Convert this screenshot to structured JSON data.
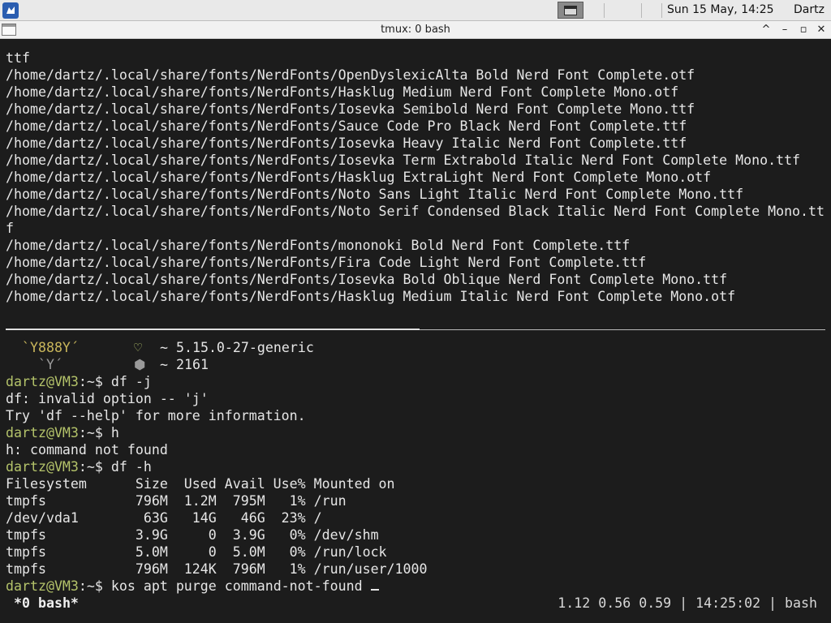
{
  "panel": {
    "clock": "Sun 15 May, 14:25",
    "user": "Dartz"
  },
  "window": {
    "title": "tmux: 0 bash",
    "controls": [
      "^",
      "–",
      "▫",
      "✕"
    ]
  },
  "terminal": {
    "lines": [
      "ttf",
      "/home/dartz/.local/share/fonts/NerdFonts/OpenDyslexicAlta Bold Nerd Font Complete.otf",
      "/home/dartz/.local/share/fonts/NerdFonts/Hasklug Medium Nerd Font Complete Mono.otf",
      "/home/dartz/.local/share/fonts/NerdFonts/Iosevka Semibold Nerd Font Complete Mono.ttf",
      "/home/dartz/.local/share/fonts/NerdFonts/Sauce Code Pro Black Nerd Font Complete.ttf",
      "/home/dartz/.local/share/fonts/NerdFonts/Iosevka Heavy Italic Nerd Font Complete.ttf",
      "/home/dartz/.local/share/fonts/NerdFonts/Iosevka Term Extrabold Italic Nerd Font Complete Mono.ttf",
      "/home/dartz/.local/share/fonts/NerdFonts/Hasklug ExtraLight Nerd Font Complete Mono.otf",
      "/home/dartz/.local/share/fonts/NerdFonts/Noto Sans Light Italic Nerd Font Complete Mono.ttf",
      "/home/dartz/.local/share/fonts/NerdFonts/Noto Serif Condensed Black Italic Nerd Font Complete Mono.tt",
      "f",
      "/home/dartz/.local/share/fonts/NerdFonts/mononoki Bold Nerd Font Complete.ttf",
      "/home/dartz/.local/share/fonts/NerdFonts/Fira Code Light Nerd Font Complete.ttf",
      "/home/dartz/.local/share/fonts/NerdFonts/Iosevka Bold Oblique Nerd Font Complete Mono.ttf",
      "/home/dartz/.local/share/fonts/NerdFonts/Hasklug Medium Italic Nerd Font Complete Mono.otf"
    ],
    "fetch": {
      "art1": "  `Y888Y´",
      "art2": "    `Y´",
      "kernel": "~ 5.15.0-27-generic",
      "packages": "~ 2161"
    },
    "prompt": "dartz@VM3",
    "prompt_suffix": ":~$ ",
    "session": [
      {
        "type": "cmd",
        "text": "df -j"
      },
      {
        "type": "out",
        "text": "df: invalid option -- 'j'"
      },
      {
        "type": "out",
        "text": "Try 'df --help' for more information."
      },
      {
        "type": "cmd",
        "text": "h"
      },
      {
        "type": "out",
        "text": "h: command not found"
      },
      {
        "type": "cmd",
        "text": "df -h"
      },
      {
        "type": "out",
        "text": "Filesystem      Size  Used Avail Use% Mounted on"
      },
      {
        "type": "out",
        "text": "tmpfs           796M  1.2M  795M   1% /run"
      },
      {
        "type": "out",
        "text": "/dev/vda1        63G   14G   46G  23% /"
      },
      {
        "type": "out",
        "text": "tmpfs           3.9G     0  3.9G   0% /dev/shm"
      },
      {
        "type": "out",
        "text": "tmpfs           5.0M     0  5.0M   0% /run/lock"
      },
      {
        "type": "out",
        "text": "tmpfs           796M  124K  796M   1% /run/user/1000"
      },
      {
        "type": "cmd",
        "text": "kos apt purge command-not-found "
      }
    ]
  },
  "statusbar": {
    "left": "*0 bash*",
    "right": "1.12 0.56 0.59 | 14:25:02 | bash"
  },
  "colors": {
    "terminal_bg": "#1c1c1c",
    "prompt": "#b4c36a",
    "fetch_art": "#c9b65b"
  }
}
